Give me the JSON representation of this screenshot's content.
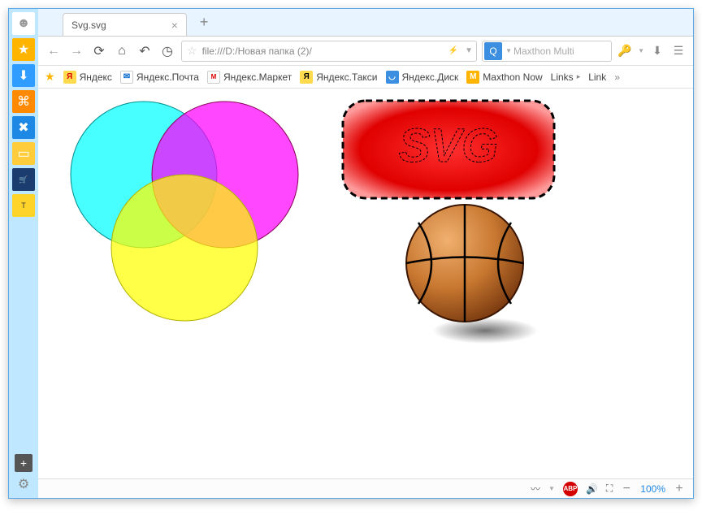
{
  "window": {
    "tab_title": "Svg.svg"
  },
  "toolbar": {
    "address": "file:///D:/Новая папка (2)/",
    "search_placeholder": "Maxthon Multi"
  },
  "bookmarks": {
    "items": [
      {
        "label": "Яндекс"
      },
      {
        "label": "Яндекс.Почта"
      },
      {
        "label": "Яндекс.Маркет"
      },
      {
        "label": "Яндекс.Такси"
      },
      {
        "label": "Яндекс.Диск"
      },
      {
        "label": "Maxthon Now"
      },
      {
        "label": "Links"
      },
      {
        "label": "Link"
      }
    ]
  },
  "content": {
    "badge_text": "SVG"
  },
  "status": {
    "zoom": "100%"
  }
}
